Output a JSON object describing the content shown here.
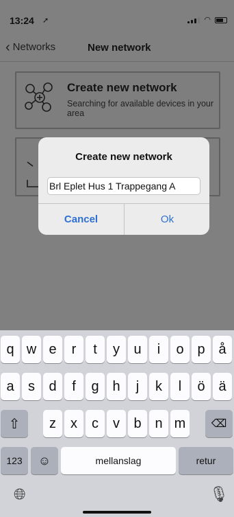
{
  "status": {
    "time": "13:24"
  },
  "nav": {
    "back_label": "Networks",
    "title": "New network"
  },
  "cards": [
    {
      "title": "Create new network",
      "subtitle": "Searching for available devices in your area"
    }
  ],
  "dialog": {
    "title": "Create new network",
    "input_value": "Brl Eplet Hus 1 Trappegang A",
    "cancel_label": "Cancel",
    "ok_label": "Ok"
  },
  "keyboard": {
    "row1": [
      "q",
      "w",
      "e",
      "r",
      "t",
      "y",
      "u",
      "i",
      "o",
      "p",
      "å"
    ],
    "row2": [
      "a",
      "s",
      "d",
      "f",
      "g",
      "h",
      "j",
      "k",
      "l",
      "ö",
      "ä"
    ],
    "row3": [
      "z",
      "x",
      "c",
      "v",
      "b",
      "n",
      "m"
    ],
    "numbers_label": "123",
    "space_label": "mellanslag",
    "return_label": "retur"
  },
  "colors": {
    "accent": "#2e6fd1",
    "dim_overlay": "#808081",
    "keyboard_bg": "#d1d3d9"
  }
}
